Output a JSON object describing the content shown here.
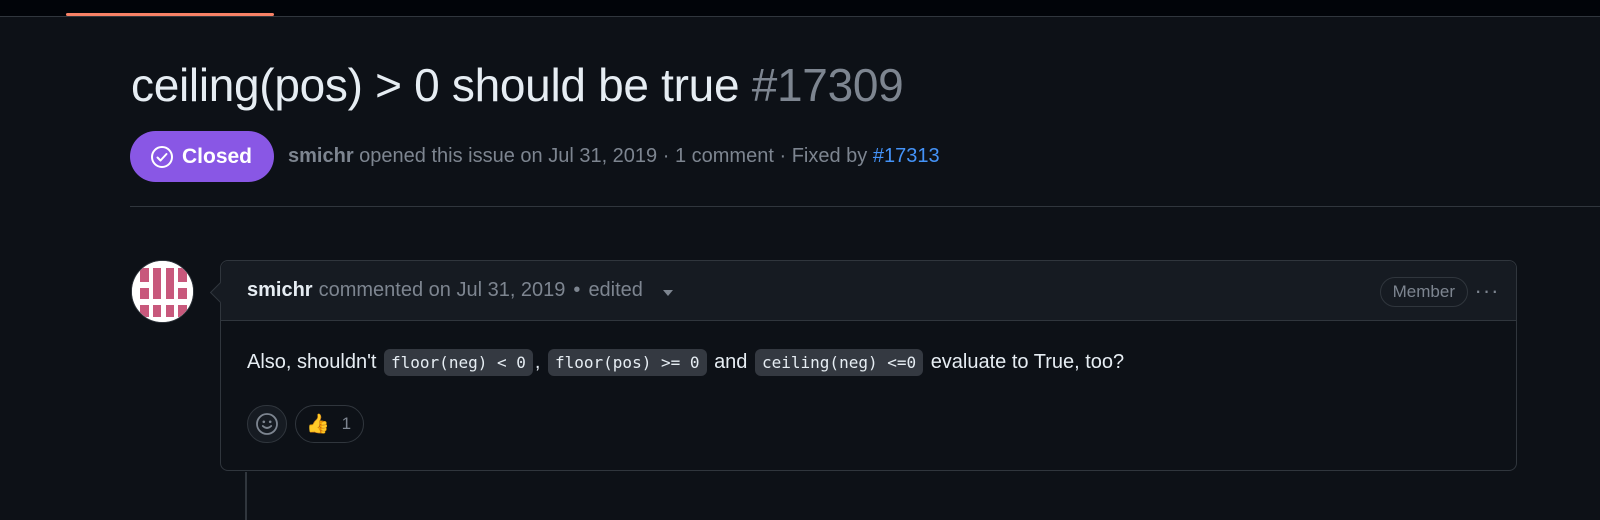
{
  "issue": {
    "title": "ceiling(pos) > 0 should be true",
    "number": "#17309",
    "status": "Closed",
    "author": "smichr",
    "opened_text": "opened this issue on Jul 31, 2019",
    "separator": "·",
    "comment_count": "1 comment",
    "fixed_by_label": "Fixed by",
    "fixed_by_link": "#17313"
  },
  "comment": {
    "author": "smichr",
    "commented_text": "commented on Jul 31, 2019",
    "bullet": "•",
    "edited_label": "edited",
    "role_badge": "Member",
    "menu_label": "···",
    "body": {
      "t1": "Also, shouldn't",
      "code1": "floor(neg) < 0",
      "t2": ",",
      "code2": "floor(pos) >= 0",
      "t3": "and",
      "code3": "ceiling(neg) <=0",
      "t4": "evaluate to True, too?"
    },
    "reactions": [
      {
        "emoji": "👍",
        "count": "1"
      }
    ]
  },
  "icons": {
    "status": "check-circle-icon",
    "add_reaction": "smiley-icon",
    "menu": "kebab-icon"
  },
  "colors": {
    "background": "#0d1117",
    "closed_badge": "#8957e5",
    "link": "#4493f8",
    "tab_underline": "#f78166",
    "avatar_pink": "#c8587c"
  }
}
